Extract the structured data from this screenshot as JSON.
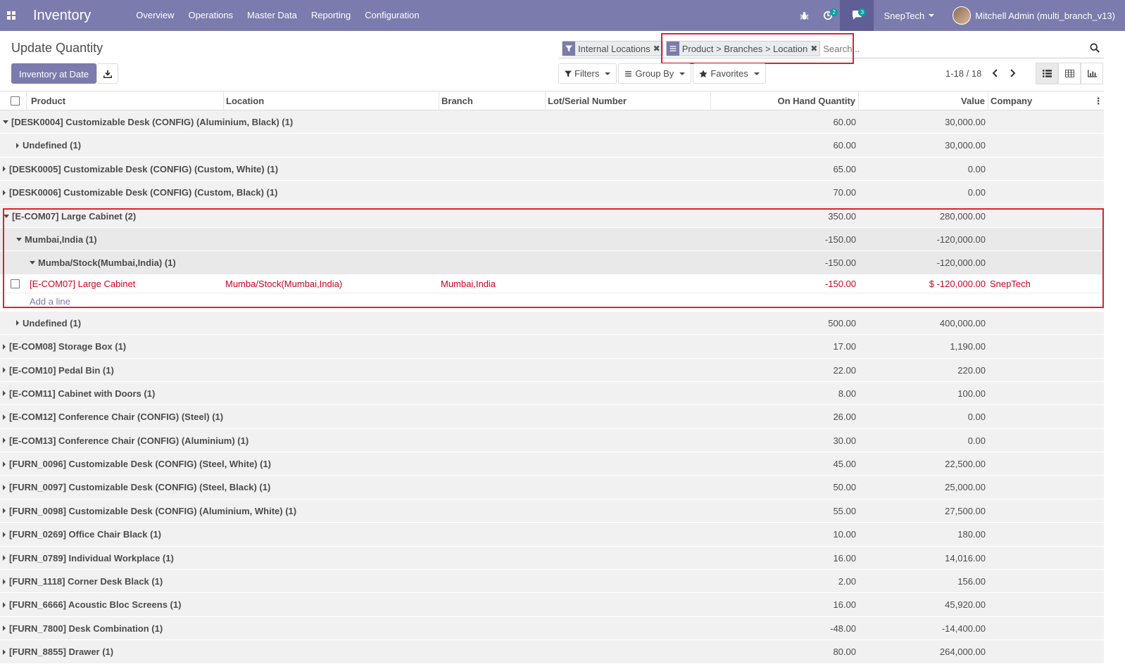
{
  "navbar": {
    "app_title": "Inventory",
    "menu": [
      "Overview",
      "Operations",
      "Master Data",
      "Reporting",
      "Configuration"
    ],
    "activity_count": "2",
    "messages_count": "3",
    "company": "SnepTech",
    "user": "Mitchell Admin (multi_branch_v13)"
  },
  "control": {
    "title": "Update Quantity",
    "inventory_at_date": "Inventory at Date"
  },
  "search": {
    "facets": [
      {
        "label": "Internal Locations",
        "icon": "filter-icon"
      },
      {
        "label": "Product > Branches > Location",
        "icon": "groupby-icon"
      }
    ],
    "placeholder": "Search..."
  },
  "filters": {
    "filters_label": "Filters",
    "groupby_label": "Group By",
    "favorites_label": "Favorites"
  },
  "pager": {
    "text": "1-18 / 18"
  },
  "table": {
    "headers": {
      "product": "Product",
      "location": "Location",
      "branch": "Branch",
      "lot": "Lot/Serial Number",
      "qty": "On Hand Quantity",
      "value": "Value",
      "company": "Company"
    },
    "groups": [
      {
        "label": "[DESK0004] Customizable Desk (CONFIG) (Aluminium, Black) (1)",
        "qty": "60.00",
        "value": "30,000.00"
      },
      {
        "label": "Undefined (1)",
        "qty": "60.00",
        "value": "30,000.00"
      },
      {
        "label": "[DESK0005] Customizable Desk (CONFIG) (Custom, White) (1)",
        "qty": "65.00",
        "value": "0.00"
      },
      {
        "label": "[DESK0006] Customizable Desk (CONFIG) (Custom, Black) (1)",
        "qty": "70.00",
        "value": "0.00"
      },
      {
        "label": "[E-COM07] Large Cabinet (2)",
        "qty": "350.00",
        "value": "280,000.00"
      },
      {
        "label": "Mumbai,India (1)",
        "qty": "-150.00",
        "value": "-120,000.00"
      },
      {
        "label": "Mumba/Stock(Mumbai,India) (1)",
        "qty": "-150.00",
        "value": "-120,000.00"
      },
      {
        "label": "Undefined (1)",
        "qty": "500.00",
        "value": "400,000.00"
      },
      {
        "label": "[E-COM08] Storage Box (1)",
        "qty": "17.00",
        "value": "1,190.00"
      },
      {
        "label": "[E-COM10] Pedal Bin (1)",
        "qty": "22.00",
        "value": "220.00"
      },
      {
        "label": "[E-COM11] Cabinet with Doors (1)",
        "qty": "8.00",
        "value": "100.00"
      },
      {
        "label": "[E-COM12] Conference Chair (CONFIG) (Steel) (1)",
        "qty": "26.00",
        "value": "0.00"
      },
      {
        "label": "[E-COM13] Conference Chair (CONFIG) (Aluminium) (1)",
        "qty": "30.00",
        "value": "0.00"
      },
      {
        "label": "[FURN_0096] Customizable Desk (CONFIG) (Steel, White) (1)",
        "qty": "45.00",
        "value": "22,500.00"
      },
      {
        "label": "[FURN_0097] Customizable Desk (CONFIG) (Steel, Black) (1)",
        "qty": "50.00",
        "value": "25,000.00"
      },
      {
        "label": "[FURN_0098] Customizable Desk (CONFIG) (Aluminium, White) (1)",
        "qty": "55.00",
        "value": "27,500.00"
      },
      {
        "label": "[FURN_0269] Office Chair Black (1)",
        "qty": "10.00",
        "value": "180.00"
      },
      {
        "label": "[FURN_0789] Individual Workplace (1)",
        "qty": "16.00",
        "value": "14,016.00"
      },
      {
        "label": "[FURN_1118] Corner Desk Black (1)",
        "qty": "2.00",
        "value": "156.00"
      },
      {
        "label": "[FURN_6666] Acoustic Bloc Screens (1)",
        "qty": "16.00",
        "value": "45,920.00"
      },
      {
        "label": "[FURN_7800] Desk Combination (1)",
        "qty": "-48.00",
        "value": "-14,400.00"
      },
      {
        "label": "[FURN_8855] Drawer (1)",
        "qty": "80.00",
        "value": "264,000.00"
      }
    ],
    "record": {
      "product": "[E-COM07] Large Cabinet",
      "location": "Mumba/Stock(Mumbai,India)",
      "branch": "Mumbai,India",
      "qty": "-150.00",
      "value": "$ -120,000.00",
      "company": "SnepTech"
    },
    "add_line": "Add a line"
  },
  "colors": {
    "navbar": "#7c7bad",
    "highlight": "#e0202f",
    "negative": "#d0021b"
  }
}
